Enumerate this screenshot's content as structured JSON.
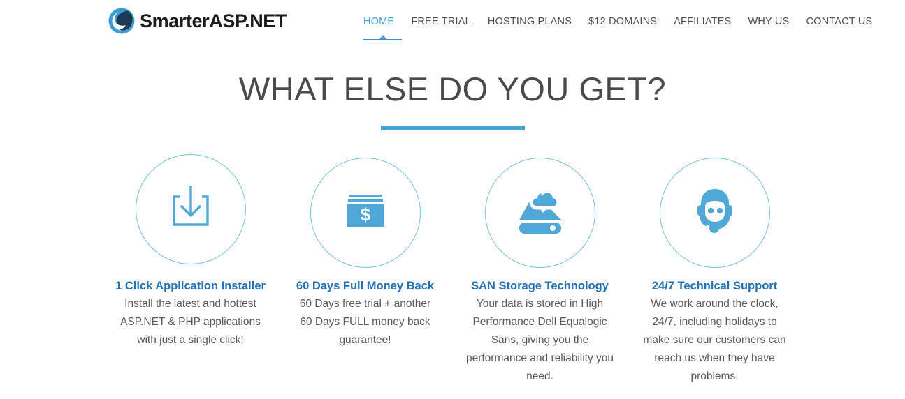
{
  "brand": {
    "logo_text": "SmarterASP.NET",
    "logo_icon": "smarterasp-swirl-logo-icon",
    "logo_arc_color": "#3c9dd4",
    "logo_drop_color": "#1d3a52"
  },
  "nav": {
    "items": [
      {
        "label": "HOME",
        "active": true
      },
      {
        "label": "FREE TRIAL",
        "active": false
      },
      {
        "label": "HOSTING PLANS",
        "active": false
      },
      {
        "label": "$12 DOMAINS",
        "active": false
      },
      {
        "label": "AFFILIATES",
        "active": false
      },
      {
        "label": "WHY US",
        "active": false
      },
      {
        "label": "CONTACT US",
        "active": false
      }
    ],
    "active_color": "#4a9fd4",
    "inactive_color": "#4f4f4f"
  },
  "section": {
    "title": "WHAT ELSE DO YOU GET?",
    "rule_color": "#42a5d5"
  },
  "features": [
    {
      "icon": "download-install-icon",
      "title": "1 Click Application Installer",
      "description": "Install the latest and hottest ASP.NET & PHP applications with just a single click!"
    },
    {
      "icon": "money-cash-dollar-icon",
      "title": "60 Days Full Money Back",
      "description": "60 Days free trial + another 60 Days FULL money back guarantee!"
    },
    {
      "icon": "cloud-storage-drive-icon",
      "title": "SAN Storage Technology",
      "description": "Your data is stored in High Performance Dell Equalogic Sans, giving you the performance and reliability you need."
    },
    {
      "icon": "support-headset-agent-icon",
      "title": "24/7 Technical Support",
      "description": "We work around the clock, 24/7, including holidays to make sure our customers can reach us when they have problems."
    }
  ],
  "theme": {
    "icon_blue": "#4fa8d8",
    "circle_stroke": "#79c2e5",
    "title_blue": "#2071b8",
    "body_gray": "#5a5a5a",
    "heading_gray": "#4a4a4a"
  }
}
